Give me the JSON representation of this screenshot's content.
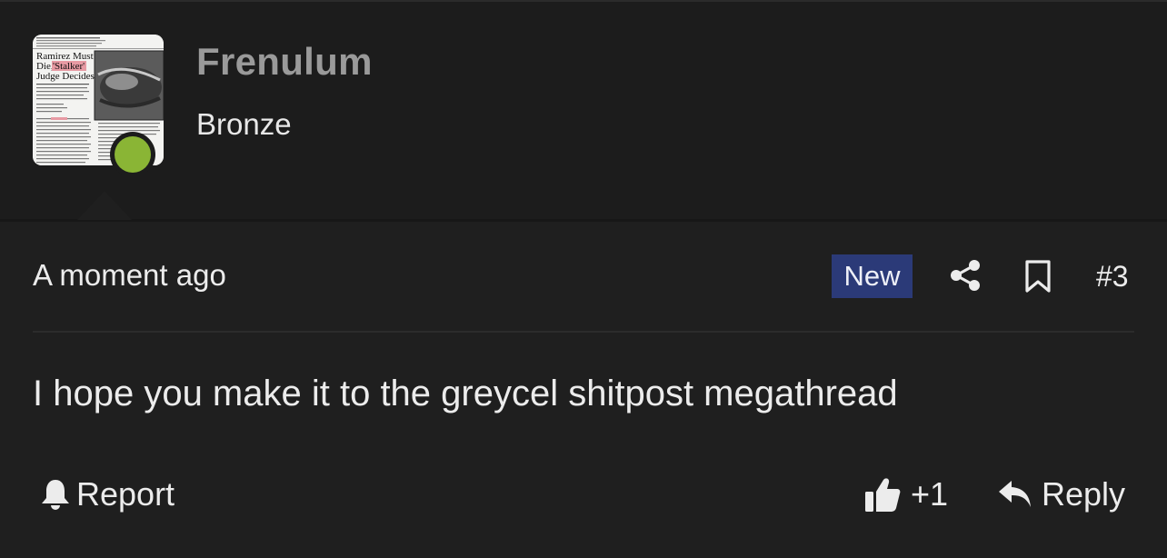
{
  "user": {
    "name": "Frenulum",
    "rank": "Bronze",
    "avatar": {
      "headline_line1": "Ramirez Must",
      "headline_line2": "Die, ",
      "headline_highlight": "'Stalker'",
      "headline_line3": "Judge Decides"
    },
    "status_color": "#8ab535"
  },
  "post": {
    "timestamp": "A moment ago",
    "badge": "New",
    "number": "#3",
    "body": "I hope you make it to the greycel shitpost megathread"
  },
  "footer": {
    "report_label": "Report",
    "like_label": "+1",
    "reply_label": "Reply"
  },
  "icons": {
    "share": "share-icon",
    "bookmark": "bookmark-icon",
    "report": "bell-icon",
    "like": "thumbs-up-icon",
    "reply": "reply-arrow-icon"
  },
  "colors": {
    "badge_bg": "#2b3a78",
    "username": "#9a9a9a"
  }
}
